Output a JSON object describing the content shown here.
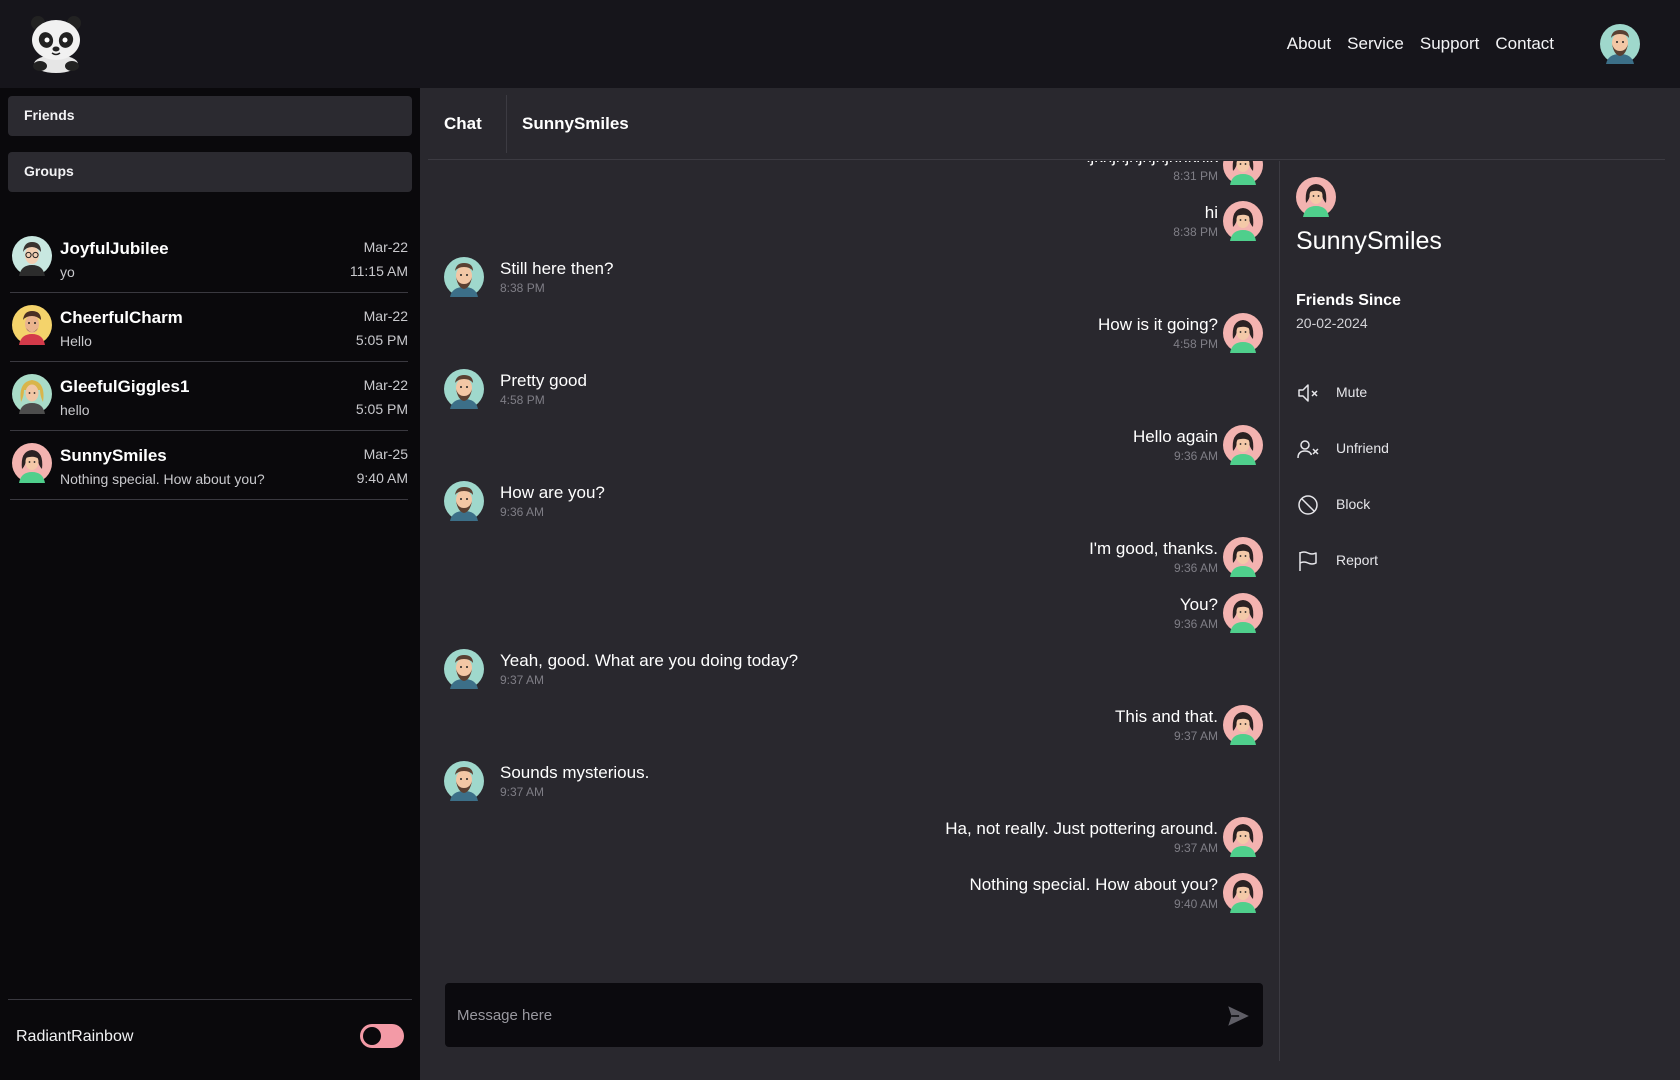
{
  "header": {
    "nav": [
      "About",
      "Service",
      "Support",
      "Contact"
    ]
  },
  "sidebar": {
    "friends_label": "Friends",
    "groups_label": "Groups",
    "conversations": [
      {
        "name": "JoyfulJubilee",
        "preview": "yo",
        "date": "Mar-22",
        "time": "11:15 AM"
      },
      {
        "name": "CheerfulCharm",
        "preview": "Hello",
        "date": "Mar-22",
        "time": "5:05 PM"
      },
      {
        "name": "GleefulGiggles1",
        "preview": "hello",
        "date": "Mar-22",
        "time": "5:05 PM"
      },
      {
        "name": "SunnySmiles",
        "preview": "Nothing special. How about you?",
        "date": "Mar-25",
        "time": "9:40 AM"
      }
    ],
    "current_user": "RadiantRainbow"
  },
  "chat": {
    "tab_label": "Chat",
    "title": "SunnySmiles",
    "messages": [
      {
        "side": "right",
        "text": "ljknjnjnjnjnjnnknlk",
        "time": "8:31 PM"
      },
      {
        "side": "right",
        "text": "hi",
        "time": "8:38 PM"
      },
      {
        "side": "left",
        "text": "Still here then?",
        "time": "8:38 PM"
      },
      {
        "side": "right",
        "text": "How is it going?",
        "time": "4:58 PM"
      },
      {
        "side": "left",
        "text": "Pretty good",
        "time": "4:58 PM"
      },
      {
        "side": "right",
        "text": "Hello again",
        "time": "9:36 AM"
      },
      {
        "side": "left",
        "text": "How are you?",
        "time": "9:36 AM"
      },
      {
        "side": "right",
        "text": "I'm good, thanks.",
        "time": "9:36 AM"
      },
      {
        "side": "right",
        "text": "You?",
        "time": "9:36 AM"
      },
      {
        "side": "left",
        "text": "Yeah, good. What are you doing today?",
        "time": "9:37 AM"
      },
      {
        "side": "right",
        "text": "This and that.",
        "time": "9:37 AM"
      },
      {
        "side": "left",
        "text": "Sounds mysterious.",
        "time": "9:37 AM"
      },
      {
        "side": "right",
        "text": "Ha, not really. Just pottering around.",
        "time": "9:37 AM"
      },
      {
        "side": "right",
        "text": "Nothing special. How about you?",
        "time": "9:40 AM"
      }
    ],
    "composer_placeholder": "Message here"
  },
  "details": {
    "name": "SunnySmiles",
    "friends_since_label": "Friends Since",
    "friends_since_value": "20-02-2024",
    "actions": [
      {
        "label": "Mute",
        "icon": "mute-icon"
      },
      {
        "label": "Unfriend",
        "icon": "unfriend-icon"
      },
      {
        "label": "Block",
        "icon": "block-icon"
      },
      {
        "label": "Report",
        "icon": "flag-icon"
      }
    ]
  },
  "colors": {
    "toggle": "#f39aa6",
    "bearded_avatar_bg": "#9fd8cc",
    "woman_avatar_bg": "#f3b3b0"
  }
}
